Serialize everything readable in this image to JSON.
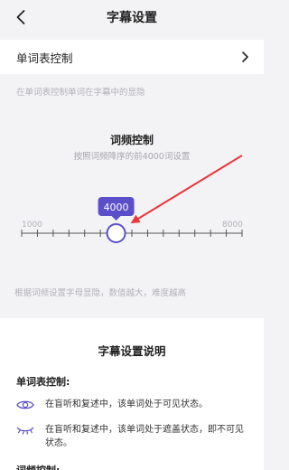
{
  "header": {
    "title": "字幕设置"
  },
  "wordlist_row": {
    "label": "单词表控制"
  },
  "wordlist_hint": "在单词表控制单词在字幕中的显隐",
  "frequency": {
    "title": "词频控制",
    "subtitle": "按照词频降序的前4000词设置",
    "min_label": "1000",
    "max_label": "8000",
    "value_label": "4000",
    "min": 1000,
    "max": 8000,
    "value": 4000,
    "hint": "根据词频设置字母显隐，数值越大，难度越高"
  },
  "help": {
    "title": "字幕设置说明",
    "section1_title": "单词表控制:",
    "items": [
      {
        "icon": "eye-open-icon",
        "text": "在盲听和复述中，该单词处于可见状态。"
      },
      {
        "icon": "eye-closed-icon",
        "text": "在盲听和复述中，该单词处于遮盖状态，即不可见状态。"
      }
    ],
    "section2_title": "词频控制:"
  },
  "colors": {
    "accent": "#5b4fc9",
    "arrow": "#e8363c"
  }
}
